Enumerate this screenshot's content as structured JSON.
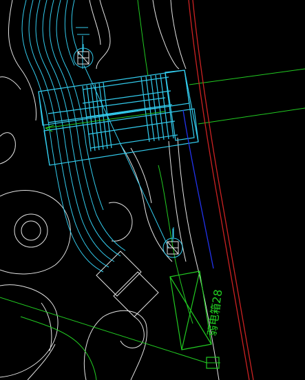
{
  "drawing": {
    "background": "#000000",
    "colors": {
      "outline": "#e6e6e6",
      "structure": "#33ccee",
      "landscape": "#22cc22",
      "boundary_red": "#cc2222",
      "boundary_blue": "#2233ee",
      "symbol": "#ffffff"
    },
    "annotation": {
      "label": "弱电箱28",
      "color": "#22cc22"
    },
    "elements": {
      "lighting_fixture_upper": "lamp-symbol-icon",
      "lighting_fixture_lower": "lamp-symbol-icon",
      "electrical_box": "weak-current-box",
      "junction_box": "junction-box"
    }
  }
}
